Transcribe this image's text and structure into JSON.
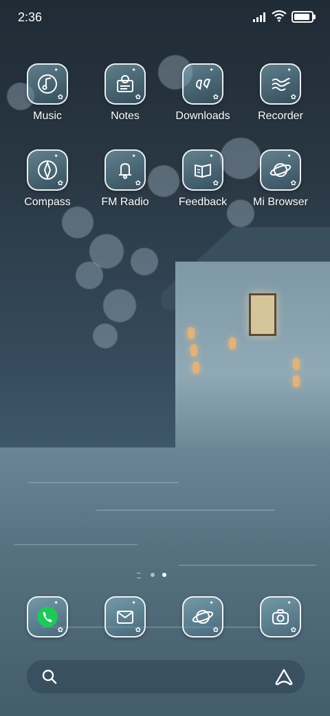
{
  "status_bar": {
    "time": "2:36",
    "battery_level": 0.9
  },
  "apps": [
    {
      "label": "Music",
      "icon": "music-note-icon"
    },
    {
      "label": "Notes",
      "icon": "notes-icon"
    },
    {
      "label": "Downloads",
      "icon": "downloads-icon"
    },
    {
      "label": "Recorder",
      "icon": "recorder-icon"
    },
    {
      "label": "Compass",
      "icon": "compass-icon"
    },
    {
      "label": "FM Radio",
      "icon": "radio-icon"
    },
    {
      "label": "Feedback",
      "icon": "feedback-icon"
    },
    {
      "label": "Mi Browser",
      "icon": "planet-icon"
    }
  ],
  "dock": [
    {
      "icon": "phone-icon",
      "accent": "#1fc85a"
    },
    {
      "icon": "messages-icon"
    },
    {
      "icon": "browser-icon"
    },
    {
      "icon": "camera-icon"
    }
  ],
  "page_indicator": {
    "pages": 2,
    "current": 2
  },
  "search_bar": {
    "left_icon": "search-icon",
    "right_icon": "assistant-icon"
  }
}
